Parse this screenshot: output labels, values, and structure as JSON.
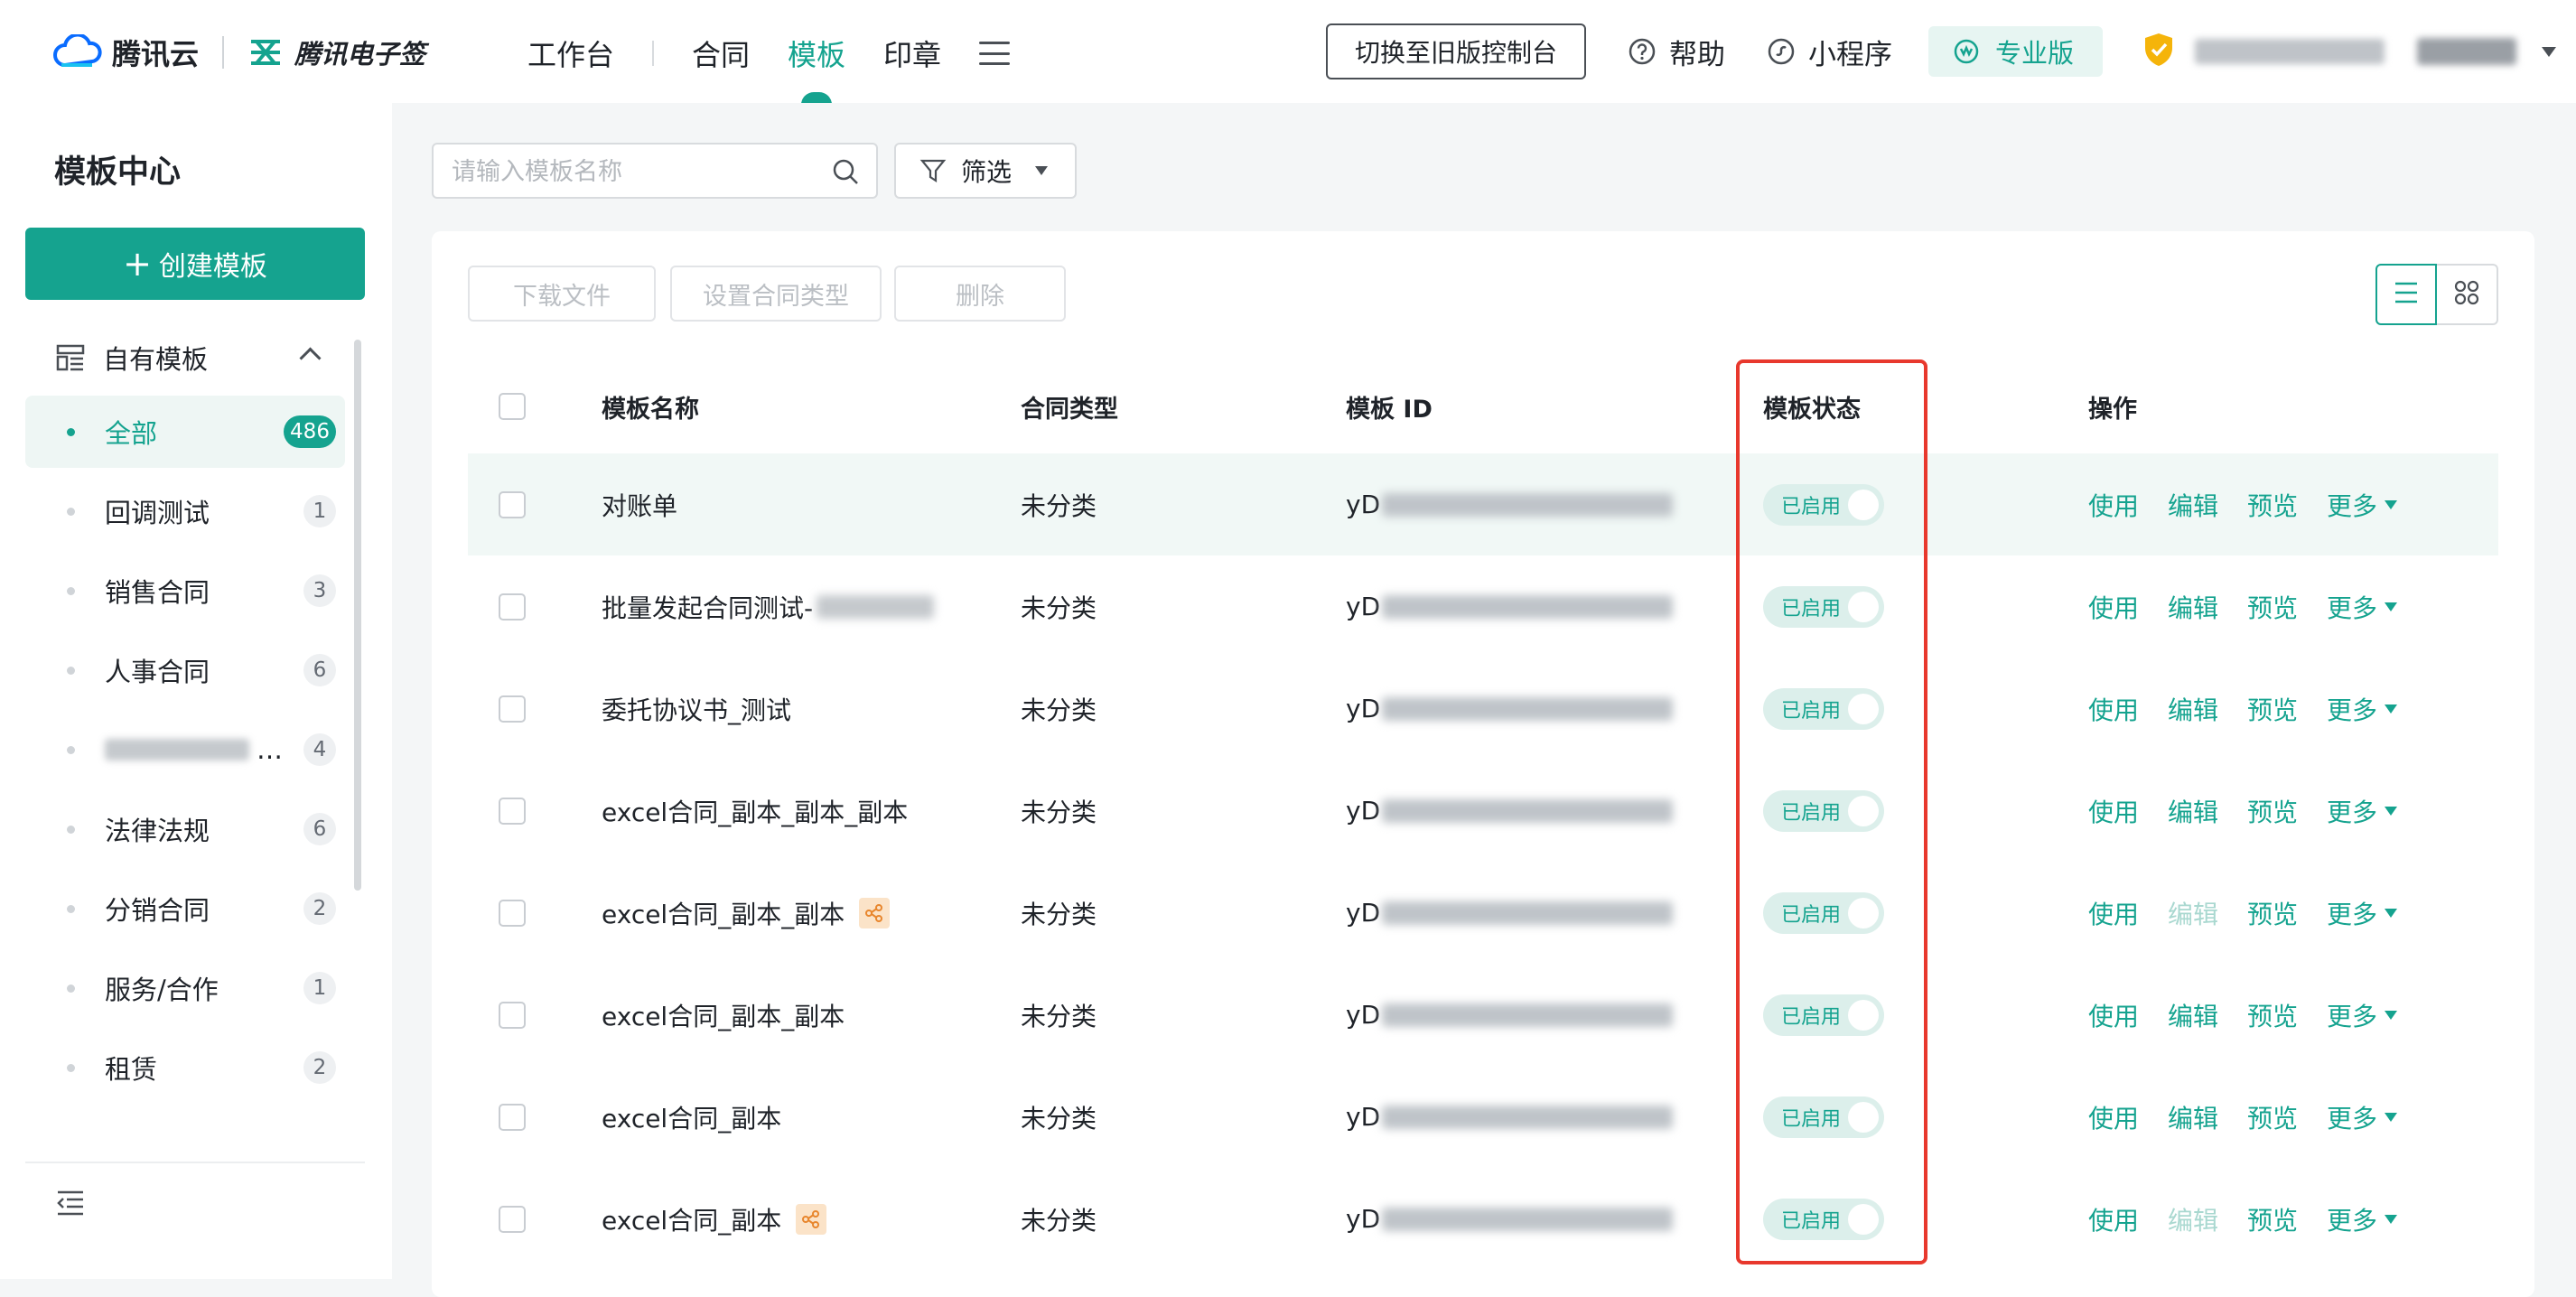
{
  "header": {
    "brand_name": "腾讯云",
    "product_name": "腾讯电子签",
    "nav": [
      {
        "label": "工作台"
      },
      {
        "label": "合同"
      },
      {
        "label": "模板"
      },
      {
        "label": "印章"
      }
    ],
    "active_nav": "模板",
    "switch_label": "切换至旧版控制台",
    "help_label": "帮助",
    "mini_program_label": "小程序",
    "pro_label": "专业版",
    "accent_color": "#15a38f"
  },
  "sidebar": {
    "title": "模板中心",
    "create_label": "创建模板",
    "group_label": "自有模板",
    "categories": [
      {
        "label": "全部",
        "count": "486"
      },
      {
        "label": "回调测试",
        "count": "1"
      },
      {
        "label": "销售合同",
        "count": "3"
      },
      {
        "label": "人事合同",
        "count": "6"
      },
      {
        "label": "…",
        "count": "4"
      },
      {
        "label": "法律法规",
        "count": "6"
      },
      {
        "label": "分销合同",
        "count": "2"
      },
      {
        "label": "服务/合作",
        "count": "1"
      },
      {
        "label": "租赁",
        "count": "2"
      }
    ]
  },
  "toolbar": {
    "search_placeholder": "请输入模板名称",
    "filter_label": "筛选",
    "download_label": "下载文件",
    "set_type_label": "设置合同类型",
    "delete_label": "删除"
  },
  "table": {
    "headers": {
      "name": "模板名称",
      "type": "合同类型",
      "id": "模板 ID",
      "state": "模板状态",
      "ops": "操作"
    },
    "rows": [
      {
        "name": "对账单",
        "type": "未分类",
        "id_prefix": "yD",
        "state": "已启用"
      },
      {
        "name": "批量发起合同测试-",
        "type": "未分类",
        "id_prefix": "yD",
        "state": "已启用"
      },
      {
        "name": "委托协议书_测试",
        "type": "未分类",
        "id_prefix": "yD",
        "state": "已启用"
      },
      {
        "name": "excel合同_副本_副本_副本",
        "type": "未分类",
        "id_prefix": "yD",
        "state": "已启用"
      },
      {
        "name": "excel合同_副本_副本",
        "type": "未分类",
        "id_prefix": "yD",
        "state": "已启用"
      },
      {
        "name": "excel合同_副本_副本",
        "type": "未分类",
        "id_prefix": "yD",
        "state": "已启用"
      },
      {
        "name": "excel合同_副本",
        "type": "未分类",
        "id_prefix": "yD",
        "state": "已启用"
      },
      {
        "name": "excel合同_副本",
        "type": "未分类",
        "id_prefix": "yD",
        "state": "已启用"
      }
    ],
    "ops": {
      "use": "使用",
      "edit": "编辑",
      "preview": "预览",
      "more": "更多"
    }
  }
}
